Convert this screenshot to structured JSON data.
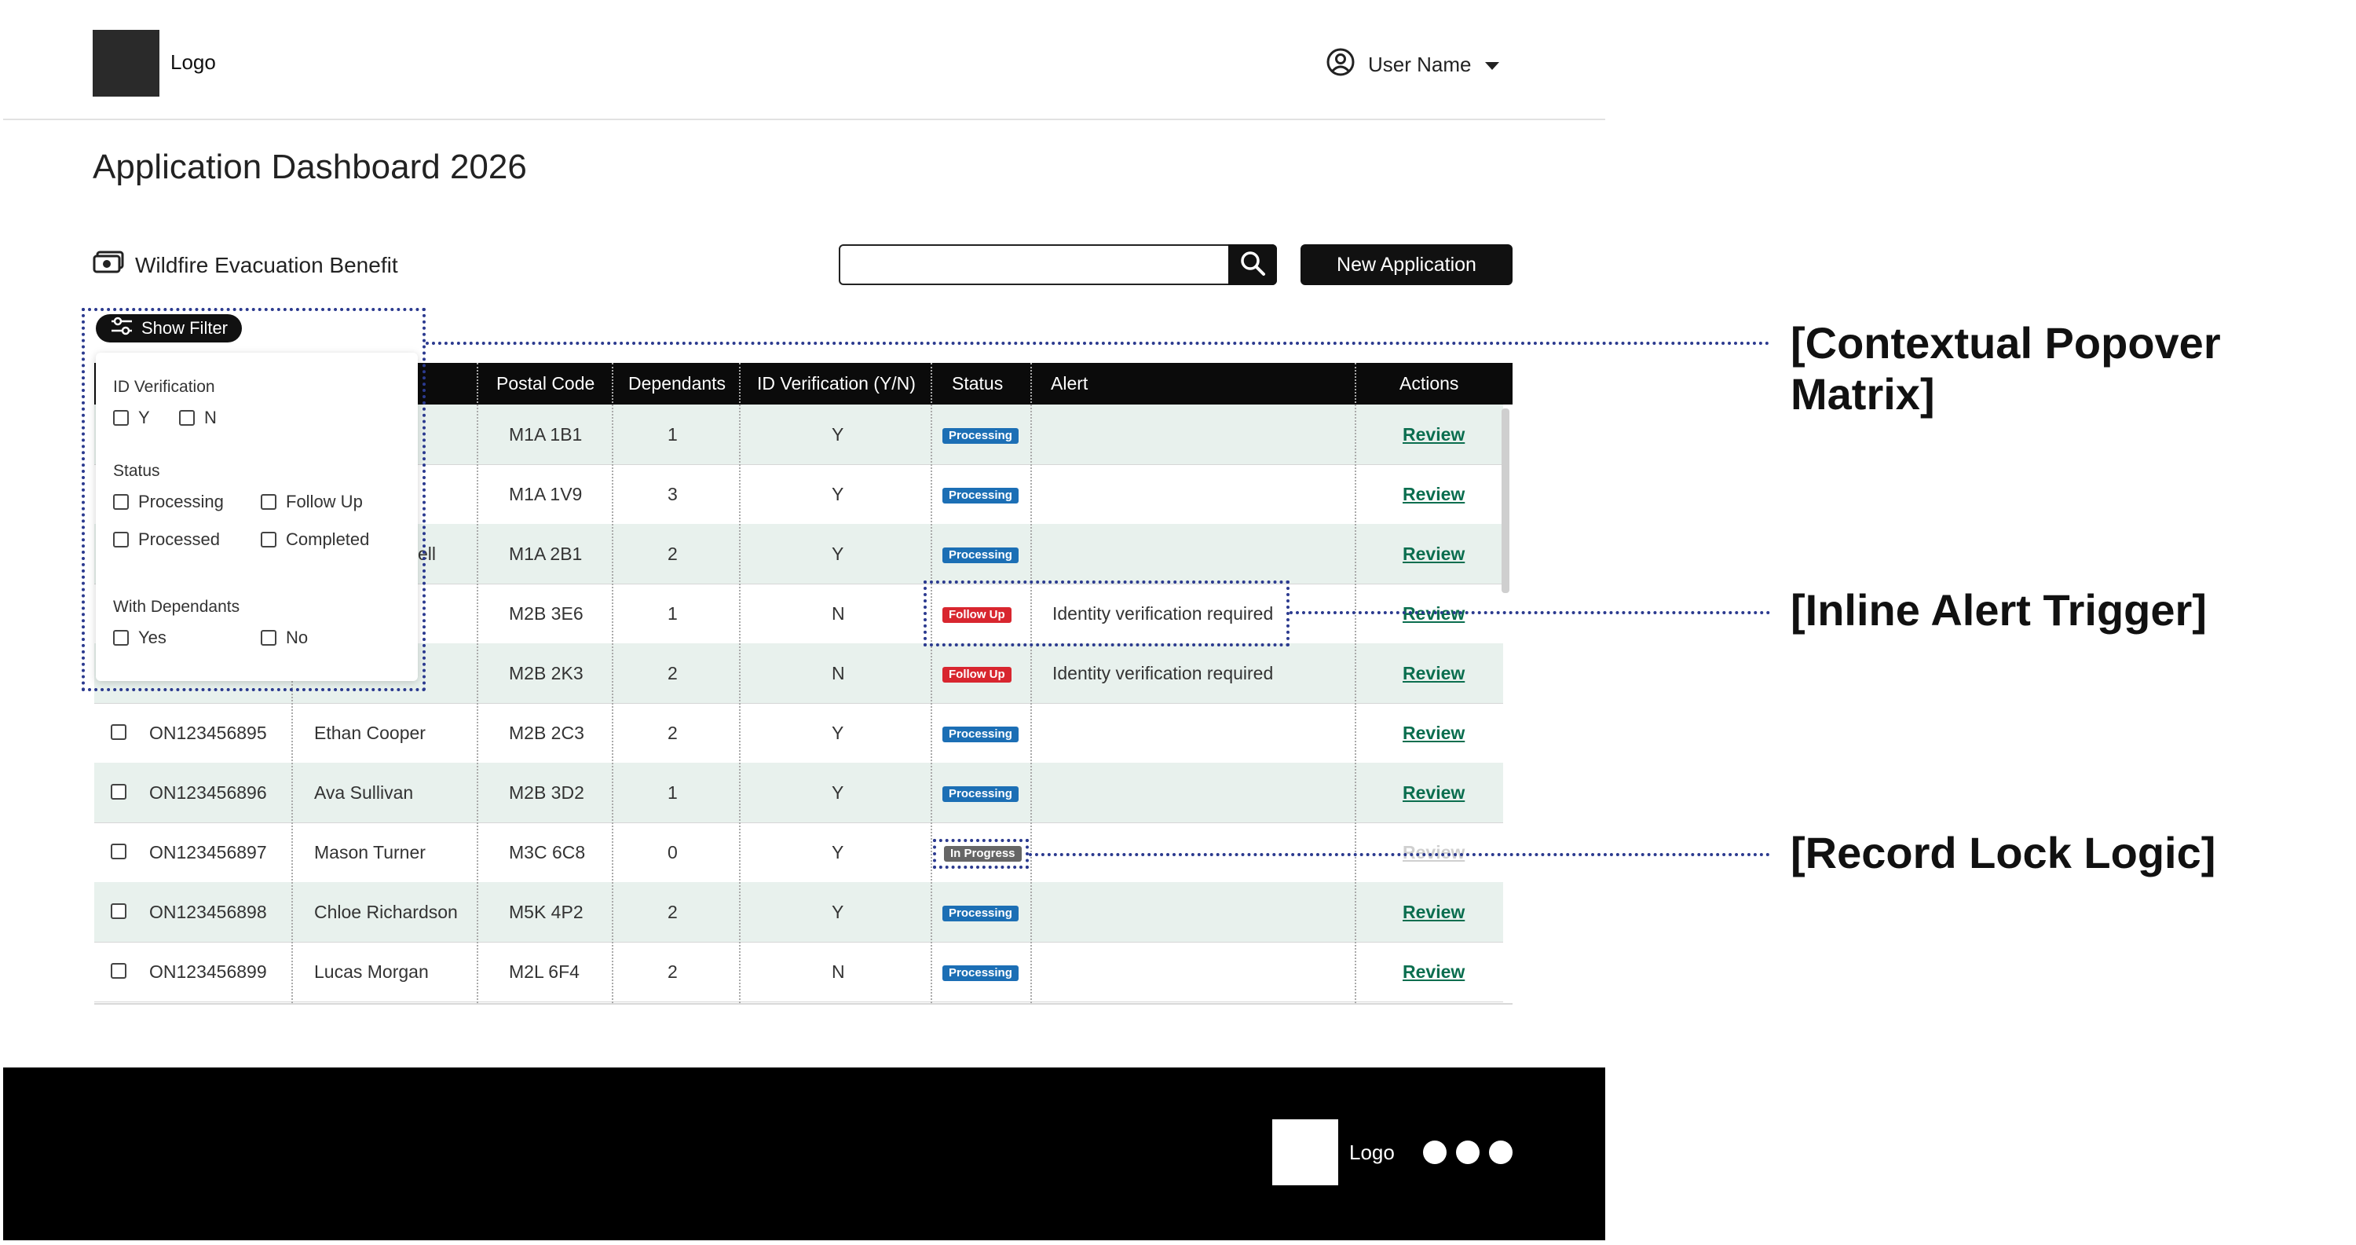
{
  "header": {
    "logo": "Logo",
    "user_name": "User Name"
  },
  "page": {
    "title": "Application Dashboard 2026",
    "program": "Wildfire Evacuation Benefit"
  },
  "search": {
    "value": "",
    "placeholder": ""
  },
  "toolbar": {
    "new_application": "New Application",
    "show_filter": "Show Filter"
  },
  "filter": {
    "id_verification": {
      "label": "ID Verification",
      "options": [
        "Y",
        "N"
      ]
    },
    "status": {
      "label": "Status",
      "options": [
        "Processing",
        "Follow Up",
        "Processed",
        "Completed"
      ]
    },
    "with_dependants": {
      "label": "With Dependants",
      "options": [
        "Yes",
        "No"
      ]
    }
  },
  "table": {
    "headers": [
      "Postal Code",
      "Dependants",
      "ID Verification (Y/N)",
      "Status",
      "Alert",
      "Actions"
    ],
    "rows": [
      {
        "id": "",
        "name": "",
        "postal": "M1A 1B1",
        "dependants": "1",
        "idv": "Y",
        "status": "Processing",
        "alert": "",
        "action": "Review"
      },
      {
        "id": "",
        "name": "",
        "postal": "M1A 1V9",
        "dependants": "3",
        "idv": "Y",
        "status": "Processing",
        "alert": "",
        "action": "Review"
      },
      {
        "id": "",
        "name": "ell",
        "postal": "M1A 2B1",
        "dependants": "2",
        "idv": "Y",
        "status": "Processing",
        "alert": "",
        "action": "Review"
      },
      {
        "id": "",
        "name": "",
        "postal": "M2B 3E6",
        "dependants": "1",
        "idv": "N",
        "status": "Follow Up",
        "alert": "Identity verification required",
        "action": "Review"
      },
      {
        "id": "",
        "name": "",
        "postal": "M2B 2K3",
        "dependants": "2",
        "idv": "N",
        "status": "Follow Up",
        "alert": "Identity verification required",
        "action": "Review"
      },
      {
        "id": "ON123456895",
        "name": "Ethan Cooper",
        "postal": "M2B 2C3",
        "dependants": "2",
        "idv": "Y",
        "status": "Processing",
        "alert": "",
        "action": "Review"
      },
      {
        "id": "ON123456896",
        "name": "Ava Sullivan",
        "postal": "M2B 3D2",
        "dependants": "1",
        "idv": "Y",
        "status": "Processing",
        "alert": "",
        "action": "Review"
      },
      {
        "id": "ON123456897",
        "name": "Mason Turner",
        "postal": "M3C 6C8",
        "dependants": "0",
        "idv": "Y",
        "status": "In Progress",
        "alert": "",
        "action": "Review"
      },
      {
        "id": "ON123456898",
        "name": "Chloe Richardson",
        "postal": "M5K 4P2",
        "dependants": "2",
        "idv": "Y",
        "status": "Processing",
        "alert": "",
        "action": "Review"
      },
      {
        "id": "ON123456899",
        "name": "Lucas Morgan",
        "postal": "M2L 6F4",
        "dependants": "2",
        "idv": "N",
        "status": "Processing",
        "alert": "",
        "action": "Review"
      }
    ]
  },
  "annotations": {
    "popover": "[Contextual Popover Matrix]",
    "alert": "[Inline Alert Trigger]",
    "lock": "[Record Lock Logic]"
  },
  "footer": {
    "logo": "Logo"
  },
  "colors": {
    "processing": "#1c6fb5",
    "follow_up": "#d8262f",
    "in_progress": "#666666",
    "row_alt": "#e8f1ed",
    "annotation": "#2b3a8f"
  }
}
